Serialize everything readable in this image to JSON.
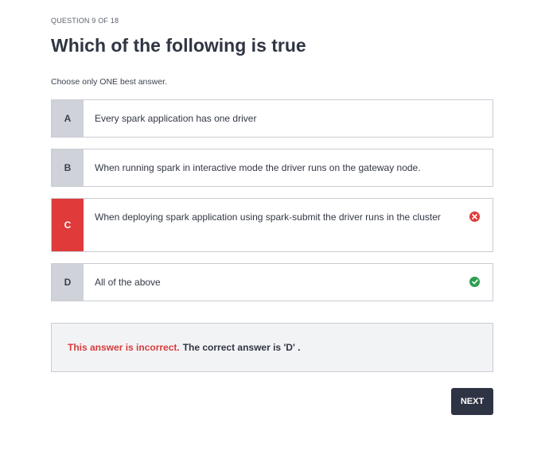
{
  "question": {
    "counter": "QUESTION 9 OF 18",
    "title": "Which of the following is true",
    "instruction": "Choose only ONE best answer."
  },
  "options": [
    {
      "letter": "A",
      "text": "Every spark application has one driver",
      "state": "neutral"
    },
    {
      "letter": "B",
      "text": "When running spark in interactive mode the driver runs on the gateway node.",
      "state": "neutral"
    },
    {
      "letter": "C",
      "text": "When deploying spark application using spark-submit the driver runs in the cluster",
      "state": "incorrect",
      "icon": "x-circle-icon"
    },
    {
      "letter": "D",
      "text": "All of the above",
      "state": "correct",
      "icon": "check-circle-icon"
    }
  ],
  "feedback": {
    "incorrect_label": "This answer is incorrect.",
    "correct_answer_text": "The correct answer is 'D' ."
  },
  "next_button": {
    "label": "NEXT"
  },
  "colors": {
    "incorrect": "#e03a3a",
    "correct": "#2e9e4f",
    "primary_button": "#2f3445"
  }
}
